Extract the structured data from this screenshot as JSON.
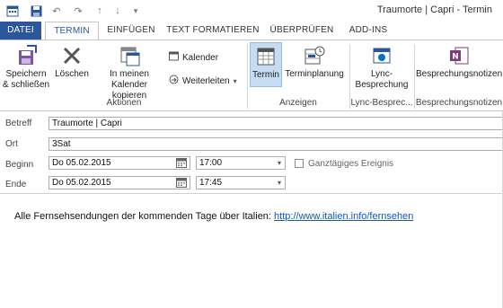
{
  "window": {
    "title": "Traumorte | Capri - Termin"
  },
  "qat": {
    "icons": [
      "calendar-app-icon",
      "save-icon",
      "undo-icon",
      "redo-icon",
      "up-icon",
      "down-icon",
      "customize-qat-icon"
    ]
  },
  "tabs": [
    {
      "label": "DATEI"
    },
    {
      "label": "TERMIN"
    },
    {
      "label": "EINFÜGEN"
    },
    {
      "label": "TEXT FORMATIEREN"
    },
    {
      "label": "ÜBERPRÜFEN"
    },
    {
      "label": "ADD-INS"
    }
  ],
  "ribbon": {
    "save_close_line1": "Speichern",
    "save_close_line2": "& schließen",
    "delete": "Löschen",
    "copy_line1": "In meinen",
    "copy_line2": "Kalender kopieren",
    "calendar": "Kalender",
    "forward": "Weiterleiten",
    "group_actions": "Aktionen",
    "appointment": "Termin",
    "scheduling": "Terminplanung",
    "group_show": "Anzeigen",
    "lync_line1": "Lync-",
    "lync_line2": "Besprechung",
    "group_lync": "Lync-Besprec...",
    "notes": "Besprechungsnotizen",
    "group_notes": "Besprechungsnotizen"
  },
  "form": {
    "subject_label": "Betreff",
    "subject_value": "Traumorte | Capri",
    "location_label": "Ort",
    "location_value": "3Sat",
    "start_label": "Beginn",
    "start_date": "Do 05.02.2015",
    "start_time": "17:00",
    "allday_label": "Ganztägiges Ereignis",
    "end_label": "Ende",
    "end_date": "Do 05.02.2015",
    "end_time": "17:45"
  },
  "body": {
    "text": "Alle Fernsehsendungen der kommenden Tage über Italien: ",
    "link": "http://www.italien.info/fernsehen"
  },
  "colors": {
    "accent": "#2b579a",
    "link": "#1155cc",
    "selected_button": "#c5dcf3"
  }
}
